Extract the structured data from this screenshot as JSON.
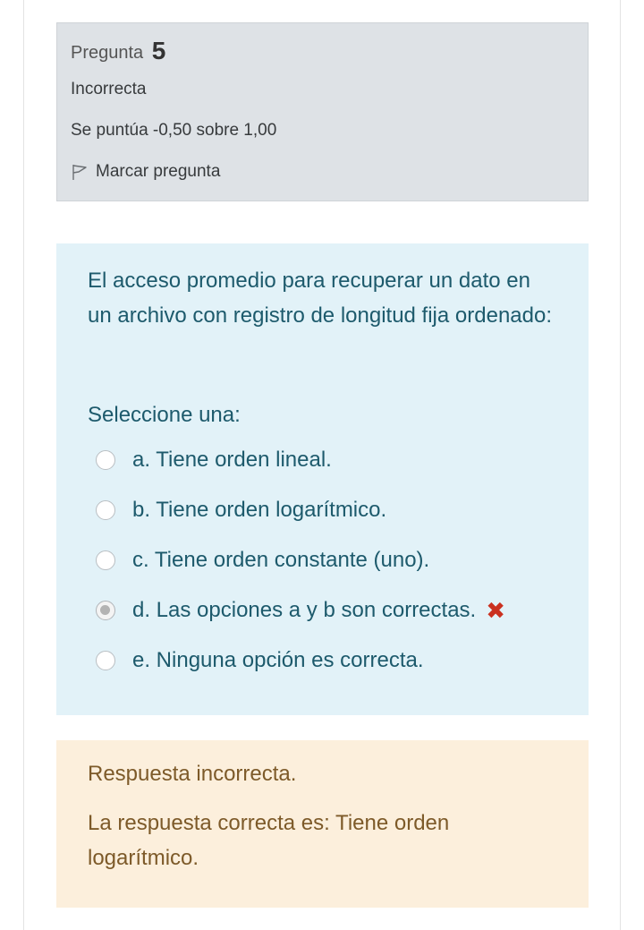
{
  "info": {
    "question_label": "Pregunta",
    "question_number": "5",
    "state": "Incorrecta",
    "grade": "Se puntúa -0,50 sobre 1,00",
    "flag_label": "Marcar pregunta",
    "flag_icon": "flag-outline-icon"
  },
  "question": {
    "text": "El acceso promedio para recuperar un dato en un archivo con registro de longitud fija ordenado:",
    "prompt": "Seleccione una:",
    "options": [
      {
        "label": "a. Tiene orden lineal.",
        "selected": false
      },
      {
        "label": "b. Tiene orden logarítmico.",
        "selected": false
      },
      {
        "label": "c. Tiene orden constante (uno).",
        "selected": false
      },
      {
        "label": "d. Las opciones a y b son correctas.",
        "selected": true,
        "marked_wrong": true
      },
      {
        "label": "e. Ninguna opción es correcta.",
        "selected": false
      }
    ],
    "wrong_icon": "✖"
  },
  "feedback": {
    "general": "Respuesta incorrecta.",
    "right_answer": "La respuesta correcta es: Tiene orden logarítmico."
  },
  "colors": {
    "info_bg": "#dee2e6",
    "question_bg": "#e2f2f8",
    "question_text": "#1d5a6c",
    "feedback_bg": "#fcefdc",
    "feedback_text": "#7d5a29",
    "incorrect_mark": "#ca3120"
  }
}
